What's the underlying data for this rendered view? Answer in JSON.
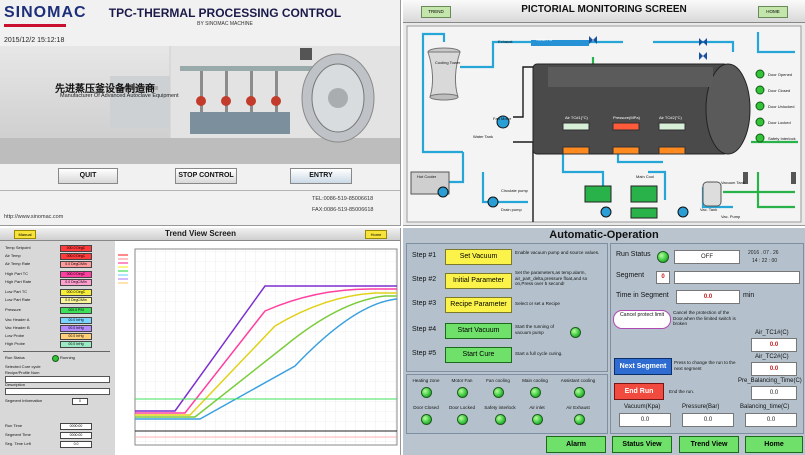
{
  "tpc": {
    "brand": "SINOMAC",
    "title": "TPC-THERMAL PROCESSING CONTROL",
    "subtitle": "BY SINOMAC MACHINE",
    "datetime": "2015/12/2 15:12:18",
    "headline_cn": "先进蒸压釜设备制造商",
    "headline_en": "Manufacturer Of Advanced Autoclave Equipment",
    "buttons": {
      "quit": "QUIT",
      "stop_control": "STOP CONTROL",
      "entry": "ENTRY"
    },
    "website": "http://www.sinomac.com",
    "tel": "TEL:0086-519-85006618",
    "fax": "FAX:0086-519-85006618"
  },
  "pictorial": {
    "title": "PICTORIAL MONITORING  SCREEN",
    "left_button": "TREND",
    "right_button": "HOME",
    "labels": {
      "cooling_tower": "Cooling Tower",
      "fan_motor": "Fan Motor",
      "exhaust": "Exhaust",
      "steam_in": "Steam In",
      "water_tank": "Water Tank",
      "hot_cooler": "Hot Cooler",
      "circulate_pump": "Circulate pump",
      "drain_pump": "Drain pump",
      "main_cool": "Main Cool",
      "vacuum_tank": "Vacuum Tank",
      "vac_pump": "Vac. Pump",
      "vac_tank": "Vac. Tank",
      "door_opened": "Door Opened",
      "door_closed": "Door Closed",
      "door_unlocked": "Door Unlocked",
      "door_locked": "Door Locked",
      "safety_interlock": "Safety Interlock"
    },
    "air_tc1": "Air TC#1(°C)",
    "pressure_mpa": "Pressure(MPa)",
    "air_tc2": "Air TC#2(°C)"
  },
  "trend": {
    "title": "Trend View Screen",
    "left_button": "Manual",
    "right_button": "Home",
    "rows": [
      {
        "label": "Temp Setpoint",
        "value": "000.0 DegC"
      },
      {
        "label": "Air Temp",
        "value": "000.0 DegC"
      },
      {
        "label": "Air Temp Rate",
        "value": "0.0 DegC/Min"
      },
      {
        "label": "High Part TC",
        "value": "000.0 DegC"
      },
      {
        "label": "High Part Rate",
        "value": "0.0 DegC/Min"
      },
      {
        "label": "Low Part TC",
        "value": "000.0 DegC"
      },
      {
        "label": "Low Part Rate",
        "value": "0.0 DegC/Min"
      },
      {
        "label": "Pressure",
        "value": "000.0 PSI"
      },
      {
        "label": "Vac Header A",
        "value": "00.0 InHg"
      },
      {
        "label": "Vac Header B",
        "value": "00.0 InHg"
      },
      {
        "label": "Low Probe",
        "value": "00.0 InHg"
      },
      {
        "label": "High Probe",
        "value": "00.0 InHg"
      }
    ],
    "status_label": "Run Status",
    "status_value": "Running",
    "info_labels": [
      "Selected Cure cycle",
      "Recipe/Profile Num",
      "Description",
      "Segment Information"
    ],
    "segment_value": "0",
    "time_rows": [
      {
        "label": "Run Time",
        "value": "0000:00"
      },
      {
        "label": "Segment Time",
        "value": "0000:00"
      },
      {
        "label": "Seg. Time Left",
        "value": "0.0"
      }
    ]
  },
  "auto": {
    "title": "Automatic-Operation",
    "steps": [
      {
        "num": "Step #1",
        "button": "Set Vacuum",
        "desc": "Enable vacuum pump and source values."
      },
      {
        "num": "Step #2",
        "button": "Initial Parameter",
        "desc": "Set the parameters,as temp.alarm, air_part_delta,pressure float,and so on,Press over 5 second!"
      },
      {
        "num": "Step #3",
        "button": "Recipe Parameter",
        "desc": "Select or set a Recipe"
      },
      {
        "num": "Step #4",
        "button": "Start Vacuum",
        "desc": "Start the running of vacuum pump"
      },
      {
        "num": "Step #5",
        "button": "Start Cure",
        "desc": "Start a full cycle curing."
      }
    ],
    "status_row1": [
      "Heating zone",
      "Motor Fan",
      "Fan cooling",
      "Main cooling",
      "Assistant cooling"
    ],
    "status_row2": [
      "Door Closed",
      "Door Locked",
      "Safety interlock",
      "Air inlet",
      "Air Exhaust"
    ],
    "run_status_label": "Run Status",
    "run_status_value": "OFF",
    "date": "2016 . 07 . 26",
    "time": "14 : 22 : 00",
    "segment_label": "Segment",
    "segment_value": "0",
    "time_in_segment_label": "Time in Segment",
    "time_in_segment_value": "0.0",
    "time_unit": "min",
    "cancel_button": "Cancel protect limit",
    "cancel_desc": "Cancel the protection of the Door,when the limited switch is broken",
    "next_segment_button": "Next Segment",
    "next_segment_desc": "Press to change the run to the next segment",
    "end_run_button": "End Run",
    "end_run_desc": "End the run.",
    "air_tc1_label": "Air_TC1#(C)",
    "air_tc1_value": "0.0",
    "air_tc2_label": "Air_TC2#(C)",
    "air_tc2_value": "0.0",
    "pre_balancing_label": "Pre_Balancing_Time(C)",
    "pre_balancing_value": "0.0",
    "vacuum_label": "Vacuum(Kpa)",
    "vacuum_value": "0.0",
    "pressure_label": "Pressure(Bar)",
    "pressure_value": "0.0",
    "balancing_label": "Balancing_time(C)",
    "balancing_value": "0.0",
    "nav": {
      "alarm": "Alarm",
      "status_view": "Status View",
      "trend_view": "Trend View",
      "home": "Home"
    }
  },
  "colors": {
    "sinomac_blue": "#1d2f7a",
    "green_led": "#33c33a",
    "button_yellow": "#fbf34a",
    "nav_green": "#6fe06a",
    "value_red": "#c21d1d"
  }
}
